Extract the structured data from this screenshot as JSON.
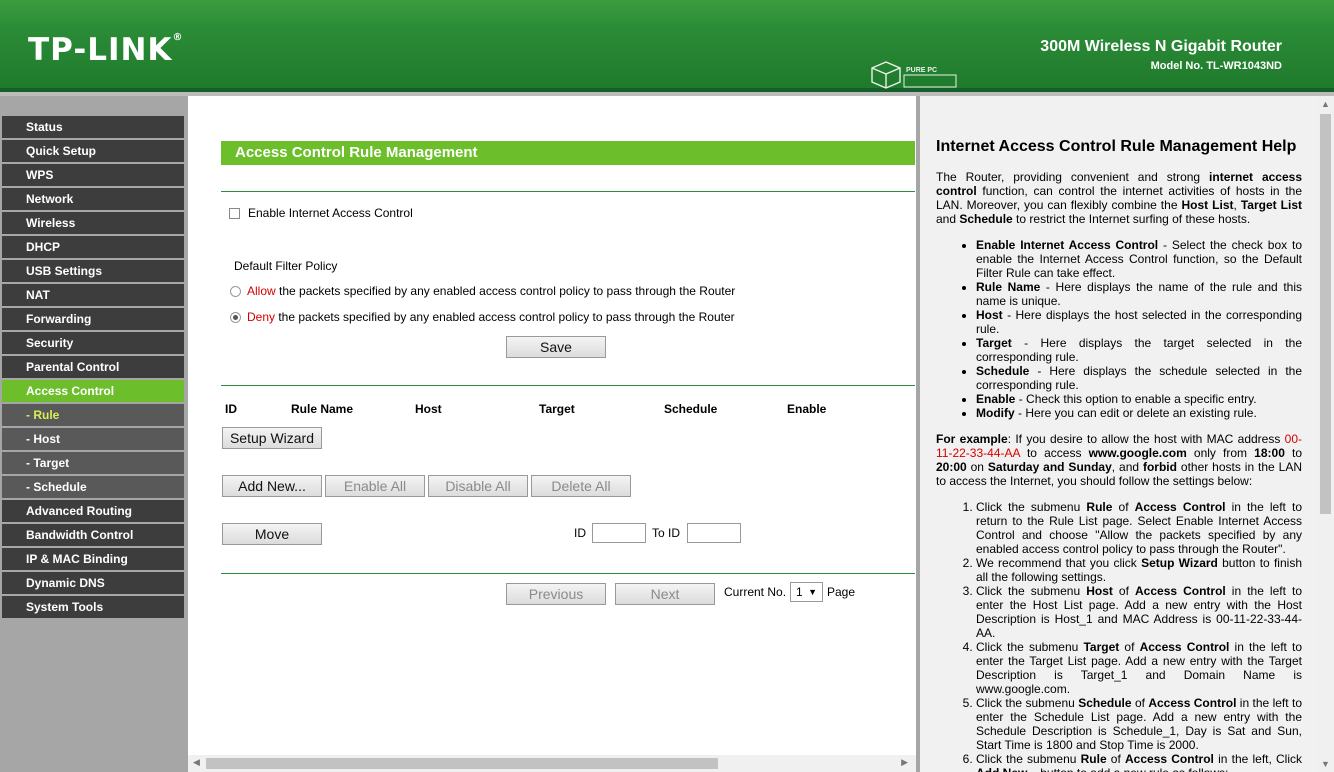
{
  "header": {
    "logo": "TP-LINK",
    "logo_mark": "®",
    "product": "300M Wireless N Gigabit Router",
    "model": "Model No. TL-WR1043ND",
    "watermark": "PURE PC"
  },
  "sidebar": {
    "items": [
      {
        "label": "Status"
      },
      {
        "label": "Quick Setup"
      },
      {
        "label": "WPS"
      },
      {
        "label": "Network"
      },
      {
        "label": "Wireless"
      },
      {
        "label": "DHCP"
      },
      {
        "label": "USB Settings"
      },
      {
        "label": "NAT"
      },
      {
        "label": "Forwarding"
      },
      {
        "label": "Security"
      },
      {
        "label": "Parental Control"
      },
      {
        "label": "Access Control"
      },
      {
        "label": "- Rule"
      },
      {
        "label": "- Host"
      },
      {
        "label": "- Target"
      },
      {
        "label": "- Schedule"
      },
      {
        "label": "Advanced Routing"
      },
      {
        "label": "Bandwidth Control"
      },
      {
        "label": "IP & MAC Binding"
      },
      {
        "label": "Dynamic DNS"
      },
      {
        "label": "System Tools"
      }
    ]
  },
  "main": {
    "title": "Access Control Rule Management",
    "enable_label": "Enable Internet Access Control",
    "policy_heading": "Default Filter Policy",
    "allow_word": "Allow",
    "allow_rest": " the packets specified by any enabled access control policy to pass through the Router",
    "deny_word": "Deny",
    "deny_rest": " the packets specified by any enabled access control policy to pass through the Router",
    "save_label": "Save",
    "columns": [
      "ID",
      "Rule Name",
      "Host",
      "Target",
      "Schedule",
      "Enable"
    ],
    "setup_wizard_label": "Setup Wizard",
    "add_new_label": "Add New...",
    "enable_all_label": "Enable All",
    "disable_all_label": "Disable All",
    "delete_all_label": "Delete All",
    "move_label": "Move",
    "id_label": "ID",
    "to_id_label": "To ID",
    "previous_label": "Previous",
    "next_label": "Next",
    "current_no_label": "Current No.",
    "current_page": "1",
    "page_label": "Page"
  },
  "help": {
    "title": "Internet Access Control Rule Management Help",
    "intro_1": "The Router, providing convenient and strong ",
    "intro_b1": "internet access control",
    "intro_2": " function, can control the internet activities of hosts in the LAN. Moreover, you can flexibly combine the ",
    "intro_b2": "Host List",
    "intro_3": ", ",
    "intro_b3": "Target List",
    "intro_4": " and ",
    "intro_b4": "Schedule",
    "intro_5": " to restrict the Internet surfing of these hosts.",
    "bullets": [
      {
        "term": "Enable Internet Access Control",
        "text": " - Select the check box to enable the Internet Access Control function, so the Default Filter Rule can take effect."
      },
      {
        "term": "Rule Name",
        "text": " - Here displays the name of the rule and this name is unique."
      },
      {
        "term": "Host",
        "text": " - Here displays the host selected in the corresponding rule."
      },
      {
        "term": "Target",
        "text": " - Here displays the target selected in the corresponding rule."
      },
      {
        "term": "Schedule",
        "text": " - Here displays the schedule selected in the corresponding rule."
      },
      {
        "term": "Enable",
        "text": " - Check this option to enable a specific entry."
      },
      {
        "term": "Modify",
        "text": " - Here you can edit or delete an existing rule."
      }
    ],
    "example_term": "For example",
    "example_1": ": If you desire to allow the host with MAC address ",
    "example_mac": "00-11-22-33-44-AA",
    "example_2": " to access ",
    "example_site": "www.google.com",
    "example_3": " only from ",
    "example_t1": "18:00",
    "example_4": " to ",
    "example_t2": "20:00",
    "example_5": " on ",
    "example_days": "Saturday and Sunday",
    "example_6": ", and ",
    "example_forbid": "forbid",
    "example_7": " other hosts in the LAN to access the Internet, you should follow the settings below:",
    "steps": [
      "Click the submenu <b>Rule</b> of <b>Access Control</b> in the left to return to the Rule List page. Select Enable Internet Access Control and choose \"Allow the packets specified by any enabled access control policy to pass through the Router\".",
      "We recommend that you click <b>Setup Wizard</b> button to finish all the following settings.",
      "Click the submenu <b>Host</b> of <b>Access Control</b> in the left to enter the Host List page. Add a new entry with the Host Description is Host_1 and MAC Address is 00-11-22-33-44-AA.",
      "Click the submenu <b>Target</b> of <b>Access Control</b> in the left to enter the Target List page. Add a new entry with the Target Description is Target_1 and Domain Name is www.google.com.",
      "Click the submenu <b>Schedule</b> of <b>Access Control</b> in the left to enter the Schedule List page. Add a new entry with the Schedule Description is Schedule_1, Day is Sat and Sun, Start Time is 1800 and Stop Time is 2000.",
      "Click the submenu <b>Rule</b> of <b>Access Control</b> in the left, Click <b>Add New...</b> button to add a new rule as follows:"
    ]
  },
  "colors": {
    "accent_green": "#6cbf2a",
    "header_green": "#2a8b36",
    "menu_dark": "#3d3d3d",
    "sub_active": "#d7ef52",
    "warn_red": "#d60000"
  }
}
